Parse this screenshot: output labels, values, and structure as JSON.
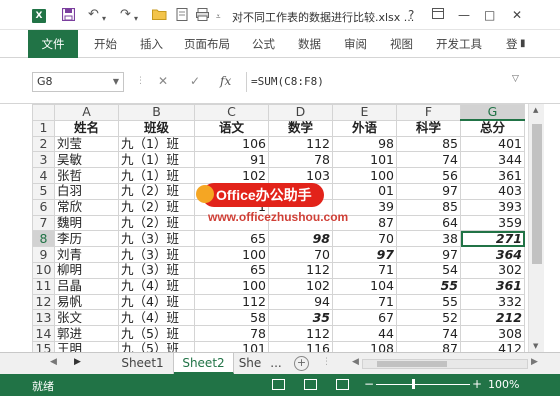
{
  "titlebar": {
    "app_icon_label": "X",
    "title": "对不同工作表的数据进行比较.xlsx ...",
    "help": "?",
    "restore": "□",
    "minimize": "—",
    "maximize": "□",
    "close": "✕"
  },
  "ribbon": {
    "tabs": [
      "文件",
      "开始",
      "插入",
      "页面布局",
      "公式",
      "数据",
      "审阅",
      "视图",
      "开发工具",
      "登"
    ]
  },
  "formula_bar": {
    "name_box": "G8",
    "cancel": "✕",
    "enter": "✓",
    "fx": "fx",
    "formula": "=SUM(C8:F8)"
  },
  "sheet": {
    "columns": [
      "A",
      "B",
      "C",
      "D",
      "E",
      "F",
      "G"
    ],
    "selected_column": "G",
    "selected_row": "8",
    "header": [
      "姓名",
      "班级",
      "语文",
      "数学",
      "外语",
      "科学",
      "总分"
    ],
    "rows": [
      {
        "n": "2",
        "cells": [
          "刘莹",
          "九（1）班",
          "106",
          "112",
          "98",
          "85",
          "401"
        ]
      },
      {
        "n": "3",
        "cells": [
          "吴敏",
          "九（1）班",
          "91",
          "78",
          "101",
          "74",
          "344"
        ]
      },
      {
        "n": "4",
        "cells": [
          "张哲",
          "九（1）班",
          "102",
          "103",
          "100",
          "56",
          "361"
        ]
      },
      {
        "n": "5",
        "cells": [
          "白羽",
          "九（2）班",
          "",
          "",
          "01",
          "97",
          "403"
        ]
      },
      {
        "n": "6",
        "cells": [
          "常欣",
          "九（2）班",
          "1",
          "",
          "39",
          "85",
          "393"
        ]
      },
      {
        "n": "7",
        "cells": [
          "魏明",
          "九（2）班",
          "",
          "",
          "87",
          "64",
          "359"
        ]
      },
      {
        "n": "8",
        "cells": [
          "李历",
          "九（3）班",
          "65",
          "98",
          "70",
          "38",
          "271"
        ]
      },
      {
        "n": "9",
        "cells": [
          "刘青",
          "九（3）班",
          "100",
          "70",
          "97",
          "97",
          "364"
        ]
      },
      {
        "n": "10",
        "cells": [
          "柳明",
          "九（3）班",
          "65",
          "112",
          "71",
          "54",
          "302"
        ]
      },
      {
        "n": "11",
        "cells": [
          "吕晶",
          "九（4）班",
          "100",
          "102",
          "104",
          "55",
          "361"
        ]
      },
      {
        "n": "12",
        "cells": [
          "易帆",
          "九（4）班",
          "112",
          "94",
          "71",
          "55",
          "332"
        ]
      },
      {
        "n": "13",
        "cells": [
          "张文",
          "九（4）班",
          "58",
          "35",
          "67",
          "52",
          "212"
        ]
      },
      {
        "n": "14",
        "cells": [
          "郭进",
          "九（5）班",
          "78",
          "112",
          "44",
          "74",
          "308"
        ]
      },
      {
        "n": "15",
        "cells": [
          "王明",
          "九（5）班",
          "101",
          "116",
          "108",
          "87",
          "412"
        ]
      }
    ],
    "emphasized_cells": [
      "8-D",
      "8-G",
      "9-E",
      "9-G",
      "11-F",
      "11-G",
      "13-D",
      "13-G"
    ]
  },
  "sheet_tabs": {
    "tabs": [
      "Sheet1",
      "Sheet2",
      "She"
    ],
    "active": "Sheet2",
    "more": "...",
    "add": "+"
  },
  "status_bar": {
    "ready": "就绪",
    "zoom_minus": "−",
    "zoom_plus": "+",
    "zoom": "100%"
  },
  "watermark": {
    "brand": "Office办公助手",
    "url": "www.officezhushou.com"
  }
}
